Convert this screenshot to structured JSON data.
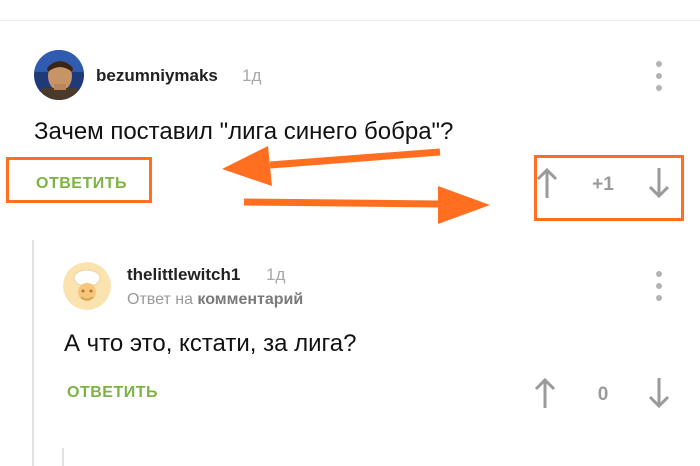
{
  "comment1": {
    "author": "bezumniymaks",
    "time": "1д",
    "text": "Зачем поставил \"лига синего бобра\"?",
    "reply_label": "ОТВЕТИТЬ",
    "score": "+1"
  },
  "comment2": {
    "author": "thelittlewitch1",
    "time": "1д",
    "reply_prefix": "Ответ на",
    "reply_target": "комментарий",
    "text": "А что это, кстати, за лига?",
    "reply_label": "ОТВЕТИТЬ",
    "score": "0"
  },
  "colors": {
    "accent_green": "#7cb342",
    "annotation_orange": "#ff6f1f",
    "muted_gray": "#9a9a9a"
  },
  "icons": {
    "menu": "more-vertical-icon",
    "upvote": "arrow-up-icon",
    "downvote": "arrow-down-icon"
  }
}
